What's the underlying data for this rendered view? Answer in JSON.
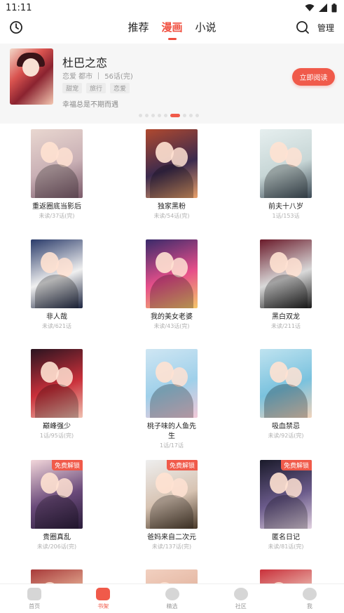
{
  "status_bar": {
    "time": "11:11"
  },
  "top_nav": {
    "tabs": [
      {
        "label": "推荐",
        "active": false
      },
      {
        "label": "漫画",
        "active": true
      },
      {
        "label": "小说",
        "active": false
      }
    ],
    "manage_label": "管理"
  },
  "banner": {
    "title": "杜巴之恋",
    "genres": "恋爱 都市",
    "chapters": "56话(完)",
    "tags": [
      "甜宠",
      "旅行",
      "恋爱"
    ],
    "description": "幸福总是不期而遇",
    "read_button": "立即阅读",
    "page_dots": 9,
    "active_dot": 5
  },
  "comics": [
    {
      "title": "重返圈底当影后",
      "progress": "未读/37话(完)",
      "badge": "",
      "colors": [
        "#e9d7d0",
        "#c9b0b5",
        "#7a5a6a"
      ]
    },
    {
      "title": "独家黑粉",
      "progress": "未读/54话(完)",
      "badge": "",
      "colors": [
        "#b0492f",
        "#3b2a4d",
        "#e8a06a"
      ]
    },
    {
      "title": "前夫十八岁",
      "progress": "1话/153话",
      "badge": "",
      "colors": [
        "#e6efef",
        "#c7d6d6",
        "#3c4a55"
      ]
    },
    {
      "title": "非人哉",
      "progress": "未读/621话",
      "badge": "",
      "colors": [
        "#2a3b6a",
        "#f0f0f0",
        "#1c2540"
      ]
    },
    {
      "title": "我的美女老婆",
      "progress": "未读/43话(完)",
      "badge": "",
      "colors": [
        "#3a2a6a",
        "#e64f8a",
        "#f4c76a"
      ]
    },
    {
      "title": "黑白双龙",
      "progress": "未读/211话",
      "badge": "",
      "colors": [
        "#6a1a2a",
        "#d9d9d9",
        "#1a1a1a"
      ]
    },
    {
      "title": "巅峰强少",
      "progress": "1话/95话(完)",
      "badge": "",
      "colors": [
        "#2a1420",
        "#c9303a",
        "#f0c0b0"
      ]
    },
    {
      "title": "桃子味的人鱼先生",
      "progress": "1话/17话",
      "badge": "",
      "colors": [
        "#cfe6f3",
        "#9fd0ea",
        "#f2c9d8"
      ]
    },
    {
      "title": "吸血禁忌",
      "progress": "未读/92话(完)",
      "badge": "",
      "colors": [
        "#bfe3f0",
        "#7ac2de",
        "#f1d3bb"
      ]
    },
    {
      "title": "贵圈真乱",
      "progress": "未读/206话(完)",
      "badge": "免费解锁",
      "colors": [
        "#f2d6da",
        "#6a4a7a",
        "#2a1c3a"
      ]
    },
    {
      "title": "爸妈来自二次元",
      "progress": "未读/137话(完)",
      "badge": "免费解锁",
      "colors": [
        "#eeeeee",
        "#d7c3b2",
        "#4a3a2a"
      ]
    },
    {
      "title": "匿名日记",
      "progress": "未读/81话(完)",
      "badge": "免费解锁",
      "colors": [
        "#1a1a2a",
        "#6a5a8a",
        "#e1d1e0"
      ]
    },
    {
      "title": "",
      "progress": "",
      "badge": "",
      "colors": [
        "#a83a3a",
        "#f2c8a8",
        "#c24a3a"
      ]
    },
    {
      "title": "",
      "progress": "",
      "badge": "",
      "colors": [
        "#f2d0c0",
        "#e0b09a",
        "#8a6a5a"
      ]
    },
    {
      "title": "",
      "progress": "",
      "badge": "",
      "colors": [
        "#c9303a",
        "#f2d6c8",
        "#5a1a1a"
      ]
    }
  ],
  "bottom_nav": [
    {
      "label": "首页",
      "icon": "home-star-icon",
      "active": false
    },
    {
      "label": "书架",
      "icon": "bookshelf-icon",
      "active": true
    },
    {
      "label": "精选",
      "icon": "featured-icon",
      "active": false
    },
    {
      "label": "社区",
      "icon": "community-chat-icon",
      "active": false
    },
    {
      "label": "我",
      "icon": "profile-icon",
      "active": false
    }
  ],
  "colors": {
    "accent": "#f05a4a",
    "muted": "#999999"
  }
}
